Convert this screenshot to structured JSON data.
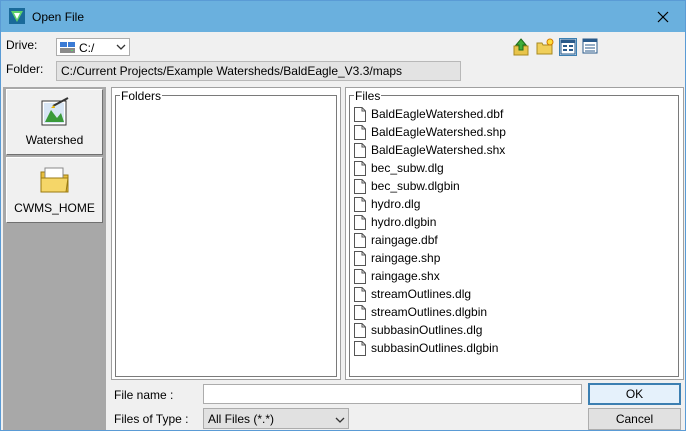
{
  "window": {
    "title": "Open File"
  },
  "drive": {
    "label": "Drive:",
    "value": "C:/"
  },
  "folder": {
    "label": "Folder:",
    "path": "C:/Current Projects/Example Watersheds/BaldEagle_V3.3/maps"
  },
  "places": [
    {
      "label": "Watershed",
      "icon": "watershed-icon"
    },
    {
      "label": "CWMS_HOME",
      "icon": "folder-icon"
    }
  ],
  "folders_panel": {
    "title": "Folders"
  },
  "files_panel": {
    "title": "Files",
    "files": [
      "BaldEagleWatershed.dbf",
      "BaldEagleWatershed.shp",
      "BaldEagleWatershed.shx",
      "bec_subw.dlg",
      "bec_subw.dlgbin",
      "hydro.dlg",
      "hydro.dlgbin",
      "raingage.dbf",
      "raingage.shp",
      "raingage.shx",
      "streamOutlines.dlg",
      "streamOutlines.dlgbin",
      "subbasinOutlines.dlg",
      "subbasinOutlines.dlgbin"
    ]
  },
  "filename": {
    "label": "File name :",
    "value": ""
  },
  "filetype": {
    "label": "Files of Type :",
    "value": "All Files (*.*)"
  },
  "buttons": {
    "ok": "OK",
    "cancel": "Cancel"
  },
  "colors": {
    "titlebar": "#6ab0de",
    "accent": "#3c7fb1",
    "places_bg": "#a8a8a8"
  }
}
